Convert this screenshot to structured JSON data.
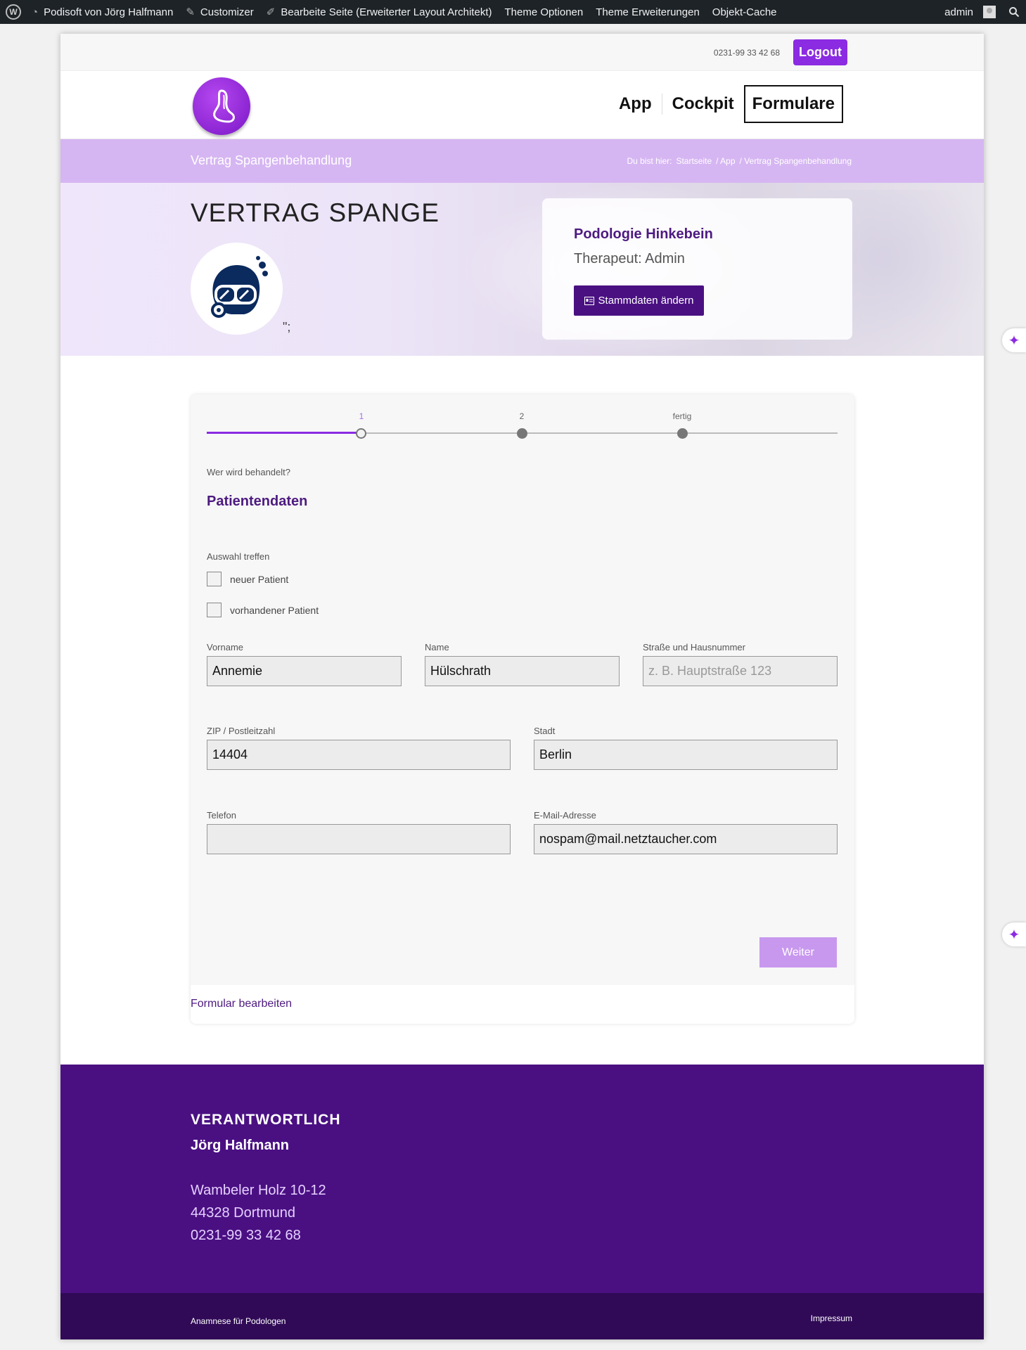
{
  "adminbar": {
    "items": [
      {
        "label": "Podisoft von Jörg Halfmann",
        "icon": "dashboard-icon"
      },
      {
        "label": "Customizer",
        "icon": "brush-icon"
      },
      {
        "label": "Bearbeite Seite (Erweiterter Layout Architekt)",
        "icon": "pencil-icon"
      },
      {
        "label": "Theme Optionen",
        "icon": ""
      },
      {
        "label": "Theme Erweiterungen",
        "icon": ""
      },
      {
        "label": "Objekt-Cache",
        "icon": ""
      }
    ],
    "user": "admin"
  },
  "topbar": {
    "phone": "0231-99 33 42 68",
    "logout": "Logout"
  },
  "nav": {
    "items": [
      "App",
      "Cockpit",
      "Formulare"
    ],
    "active": "Formulare"
  },
  "titlebar": {
    "title": "Vertrag Spangenbehandlung",
    "crumb_prefix": "Du bist hier:",
    "crumbs": [
      "Startseite",
      "/ App",
      "/ Vertrag Spangenbehandlung"
    ]
  },
  "hero": {
    "heading": "VERTRAG SPANGE",
    "stray_text": "\";",
    "card": {
      "name": "Podologie Hinkebein",
      "therapist": "Therapeut: Admin",
      "button": "Stammdaten ändern"
    }
  },
  "form": {
    "steps": [
      "1",
      "2",
      "fertig"
    ],
    "current_step": 1,
    "subtitle": "Wer wird behandelt?",
    "title": "Patientendaten",
    "choice_label": "Auswahl treffen",
    "choices": [
      "neuer Patient",
      "vorhandener Patient"
    ],
    "fields": {
      "vorname": {
        "label": "Vorname",
        "value": "Annemie"
      },
      "name": {
        "label": "Name",
        "value": "Hülschrath"
      },
      "strasse": {
        "label": "Straße und Hausnummer",
        "value": "",
        "placeholder": "z. B. Hauptstraße 123"
      },
      "zip": {
        "label": "ZIP / Postleitzahl",
        "value": "14404"
      },
      "stadt": {
        "label": "Stadt",
        "value": "Berlin"
      },
      "telefon": {
        "label": "Telefon",
        "value": ""
      },
      "email": {
        "label": "E-Mail-Adresse",
        "value": "nospam@mail.netztaucher.com"
      }
    },
    "next_button": "Weiter",
    "edit_link": "Formular bearbeiten"
  },
  "footer": {
    "heading": "VERANTWORTLICH",
    "name": "Jörg Halfmann",
    "address": [
      "Wambeler Holz 10-12",
      "44328 Dortmund",
      "0231-99 33 42 68"
    ],
    "bottom_left": "Anamnese für Podologen",
    "bottom_right": "Impressum"
  },
  "colors": {
    "accent": "#8b2be2",
    "dark_purple": "#4a1082",
    "light_purple": "#d6b6f2"
  }
}
